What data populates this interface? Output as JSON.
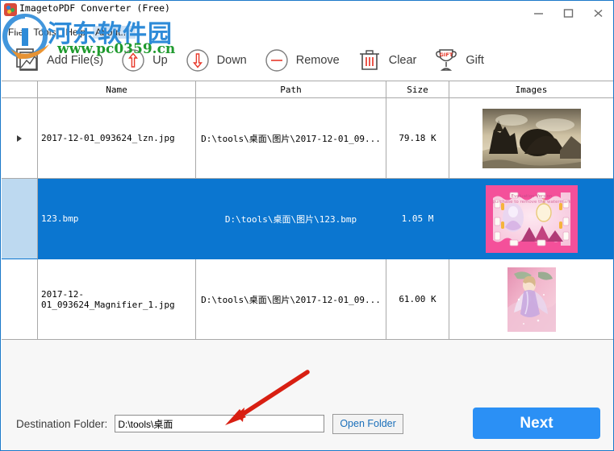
{
  "window": {
    "title": "ImagetoPDF Converter (Free)",
    "app_icon": "app-logo-icon",
    "controls": {
      "minimize": "minimize-icon",
      "maximize": "maximize-icon",
      "close": "close-icon"
    }
  },
  "menubar": {
    "items": [
      {
        "label": "File",
        "highlight": false
      },
      {
        "label": "Tools",
        "highlight": false
      },
      {
        "label": "Help",
        "highlight": false
      },
      {
        "label": "About...",
        "highlight": true
      }
    ]
  },
  "toolbar": {
    "items": [
      {
        "label": "Add File(s)",
        "icon": "add-image-icon"
      },
      {
        "label": "Up",
        "icon": "arrow-up-circle-icon"
      },
      {
        "label": "Down",
        "icon": "arrow-down-circle-icon"
      },
      {
        "label": "Remove",
        "icon": "minus-circle-icon"
      },
      {
        "label": "Clear",
        "icon": "trash-icon"
      },
      {
        "label": "Gift",
        "icon": "trophy-gift-icon"
      }
    ]
  },
  "table": {
    "columns": [
      "",
      "Name",
      "Path",
      "Size",
      "Images"
    ],
    "rows": [
      {
        "marker": "current-row-arrow",
        "name": "2017-12-01_093624_lzn.jpg",
        "path": "D:\\tools\\桌面\\图片\\2017-12-01_09...",
        "size": "79.18 K",
        "thumbnail": "sepia-landscape-thumbnail",
        "selected": false
      },
      {
        "marker": "",
        "name": "123.bmp",
        "path": "D:\\tools\\桌面\\图片\\123.bmp",
        "size": "1.05 M",
        "thumbnail": "pink-frame-watermarked-thumbnail",
        "selected": true
      },
      {
        "marker": "",
        "name": "2017-12-01_093624_Magnifier_1.jpg",
        "path": "D:\\tools\\桌面\\图片\\2017-12-01_09...",
        "size": "61.00 K",
        "thumbnail": "pink-angel-portrait-thumbnail",
        "selected": false
      }
    ]
  },
  "footer": {
    "destination_label": "Destination Folder:",
    "destination_value": "D:\\tools\\桌面",
    "destination_placeholder": "",
    "open_folder_label": "Open Folder",
    "next_label": "Next"
  },
  "annotation": {
    "arrow": "red-pointer-arrow"
  },
  "watermark": {
    "site_name": "河东软件园",
    "site_url": "www.pc0359.cn",
    "logo": "watermark-logo-icon"
  },
  "colors": {
    "window_border": "#1b79c9",
    "selection_blue": "#0b76d0",
    "selection_marker_blue": "#bdd9f0",
    "next_button_blue": "#2b90f5",
    "accent_red": "#e8392b",
    "watermark_blue": "#2e8bd8",
    "watermark_green": "#1f9a2e"
  }
}
